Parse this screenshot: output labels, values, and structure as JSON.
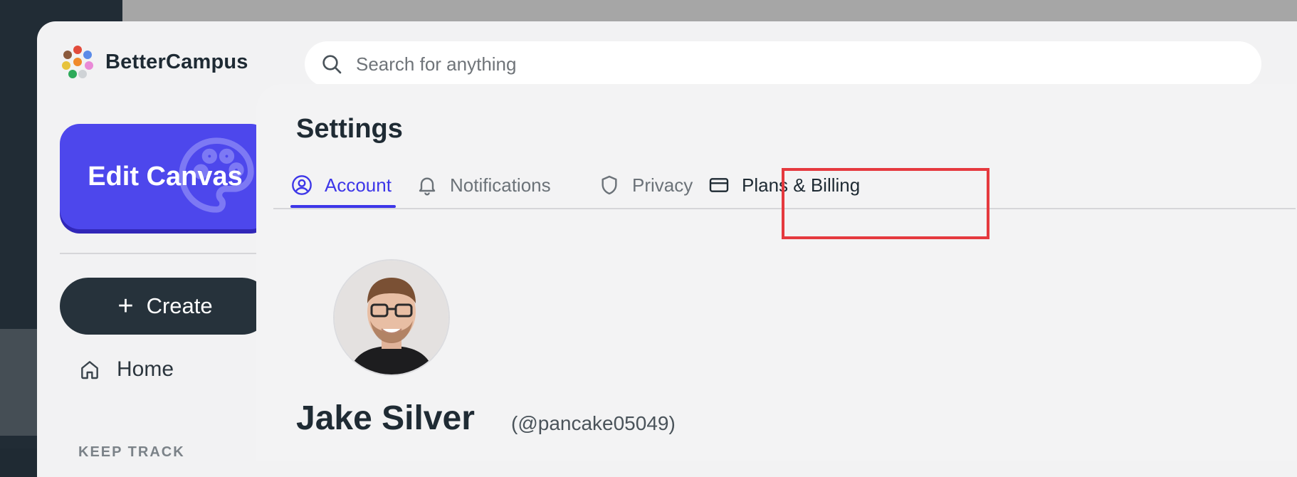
{
  "app": {
    "name": "BetterCampus"
  },
  "search": {
    "placeholder": "Search for anything"
  },
  "sidebar": {
    "edit_canvas_label": "Edit Canvas",
    "create_label": "Create",
    "home_label": "Home",
    "section_label": "KEEP TRACK"
  },
  "settings": {
    "title": "Settings",
    "tabs": [
      {
        "label": "Account",
        "icon": "user-circle-icon",
        "active": true
      },
      {
        "label": "Notifications",
        "icon": "bell-icon",
        "active": false
      },
      {
        "label": "Privacy",
        "icon": "shield-icon",
        "active": false
      },
      {
        "label": "Plans & Billing",
        "icon": "credit-card-icon",
        "active": false,
        "highlighted": true
      }
    ]
  },
  "profile": {
    "name": "Jake Silver",
    "handle": "(@pancake05049)"
  },
  "colors": {
    "accent": "#4d47ec",
    "active_tab": "#3d36e8",
    "dark_button": "#26323b",
    "highlight_box": "#e5393e"
  }
}
